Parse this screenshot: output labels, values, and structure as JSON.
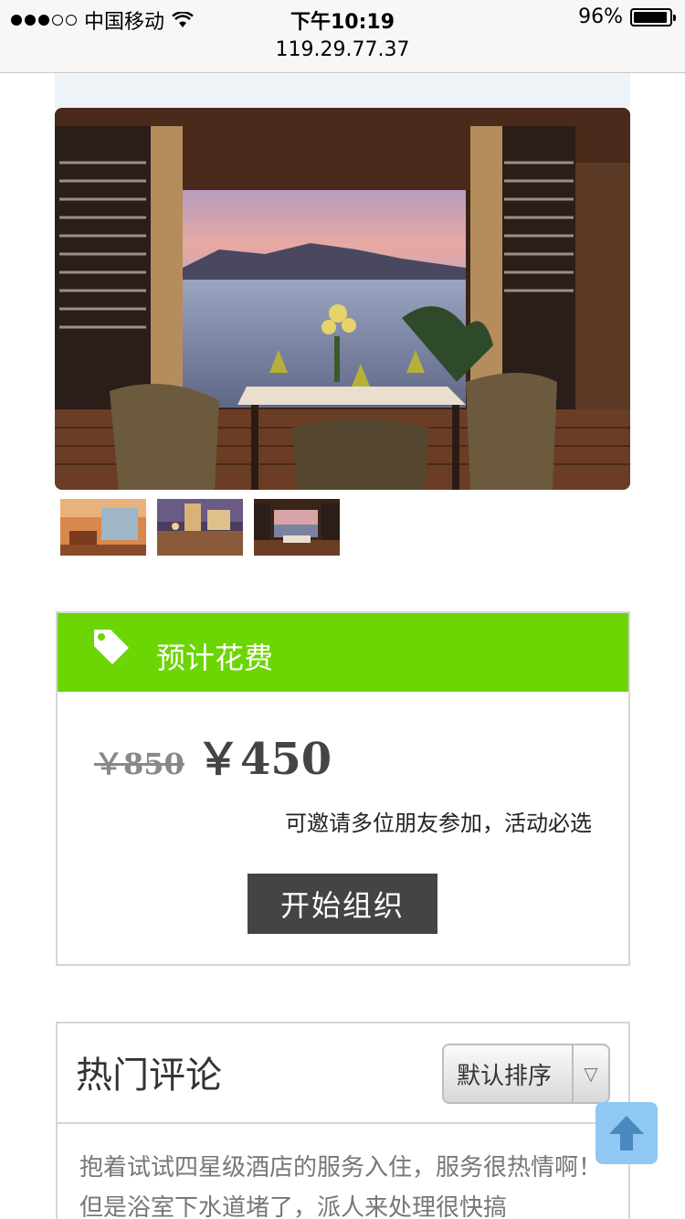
{
  "status_bar": {
    "carrier": "中国移动",
    "time": "下午10:19",
    "url": "119.29.77.37",
    "battery": "96%",
    "battery_level": 0.96
  },
  "gallery": {
    "main_image": "hotel-terrace-dining-photo",
    "thumbnails": [
      "hotel-room-photo",
      "night-waterfront-photo",
      "terrace-dining-photo"
    ]
  },
  "price_card": {
    "title": "预计花费",
    "old_price": "￥850",
    "new_price": "￥450",
    "note": "可邀请多位朋友参加，活动必选",
    "start_button": "开始组织",
    "header_color": "#6cd504"
  },
  "comments": {
    "title": "热门评论",
    "sort_selected": "默认排序",
    "first_comment": "抱着试试四星级酒店的服务入住，服务很热情啊！但是浴室下水道堵了，派人来处理很快搞"
  }
}
